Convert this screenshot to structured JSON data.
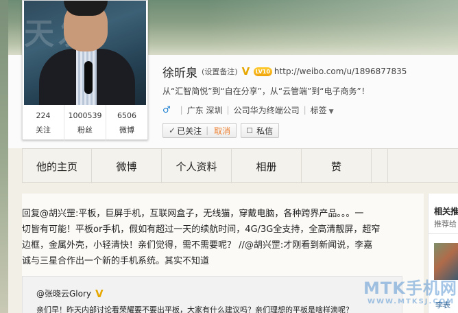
{
  "profile": {
    "name": "徐昕泉",
    "remark_link": "(设置备注)",
    "verified_badge": "V",
    "level_badge": "LV10",
    "url": "http://weibo.com/u/1896877835",
    "bio": "从“汇智简悦”到“自在分享”，从“云管端”到“电子商务”！",
    "gender_icon": "male-icon",
    "location": "广东 深圳",
    "company": "公司华为终端公司",
    "tags_label": "标签",
    "avatar_bg_text": "天发"
  },
  "stats": [
    {
      "num": "224",
      "label": "关注"
    },
    {
      "num": "1000539",
      "label": "粉丝"
    },
    {
      "num": "6506",
      "label": "微博"
    }
  ],
  "actions": {
    "followed_label": "已关注",
    "cancel_label": "取消",
    "message_label": "私信"
  },
  "tabs": [
    {
      "label": "他的主页"
    },
    {
      "label": "微博"
    },
    {
      "label": "个人资料"
    },
    {
      "label": "相册"
    },
    {
      "label": "赞"
    }
  ],
  "post": {
    "text_line1": "回复@胡兴罡:平板，巨屏手机，互联网盒子，无线猫，穿戴电脑，各种跨界产品。。。一",
    "text_line2": "切皆有可能！平板or手机，假如有超过一天的续航时间，4G/3G全支持，全高清靓屏，超窄",
    "text_line3": "边框，金属外壳，小轻清快！亲们觉得，需不需要呢？ //@胡兴罡:才刚看到新闻说，李嘉",
    "text_line4": "诚与三星合作出一个新的手机系统。其实不知道"
  },
  "quoted": {
    "author": "@张晓云Glory",
    "badge": "V",
    "text": "亲们早！昨天内部讨论看荣耀要不要出平板，大家有什么建议吗？亲们理想的平板是啥样滴呢？"
  },
  "side": {
    "title": "相关推",
    "subtitle": "推荐给",
    "next_label": "李表"
  },
  "watermark": {
    "main": "MTK手机网",
    "sub": "WWW.MTKSJ.COM"
  }
}
